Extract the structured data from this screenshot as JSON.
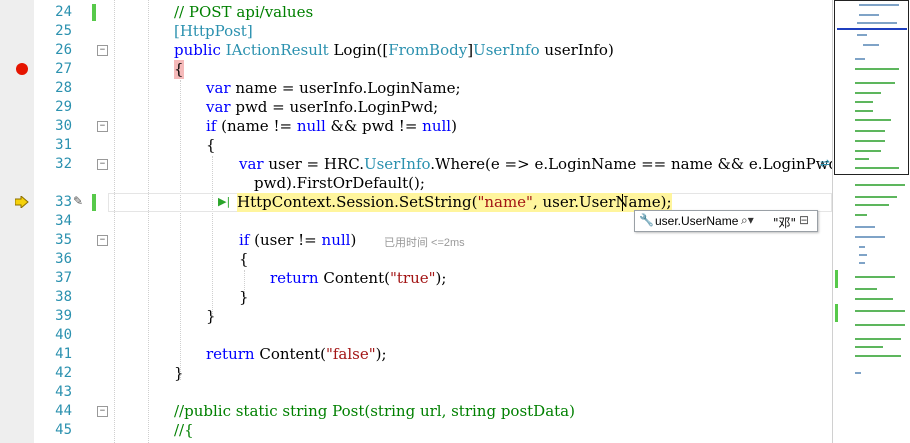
{
  "lines": [
    {
      "num": "24",
      "text": "// POST api/values"
    },
    {
      "num": "25",
      "text": "[HttpPost]"
    },
    {
      "num": "26",
      "text": "public IActionResult Login([FromBody]UserInfo userInfo)"
    },
    {
      "num": "27",
      "text": "{"
    },
    {
      "num": "28",
      "text": "var name = userInfo.LoginName;"
    },
    {
      "num": "29",
      "text": "var pwd = userInfo.LoginPwd;"
    },
    {
      "num": "30",
      "text": "if (name != null && pwd != null)"
    },
    {
      "num": "31",
      "text": "{"
    },
    {
      "num": "32",
      "text": "var user = HRC.UserInfo.Where(e => e.LoginName == name && e.LoginPwd =="
    },
    {
      "num": "",
      "text": "pwd).FirstOrDefault();"
    },
    {
      "num": "33",
      "text": "HttpContext.Session.SetString(\"name\", user.UserName);"
    },
    {
      "num": "34",
      "text": ""
    },
    {
      "num": "35",
      "text": "if (user != null)"
    },
    {
      "num": "36",
      "text": "{"
    },
    {
      "num": "37",
      "text": "return Content(\"true\");"
    },
    {
      "num": "38",
      "text": "}"
    },
    {
      "num": "39",
      "text": "}"
    },
    {
      "num": "40",
      "text": ""
    },
    {
      "num": "41",
      "text": "return Content(\"false\");"
    },
    {
      "num": "42",
      "text": "}"
    },
    {
      "num": "43",
      "text": ""
    },
    {
      "num": "44",
      "text": "//public static string Post(string url, string postData)"
    },
    {
      "num": "45",
      "text": "//{"
    }
  ],
  "perf_tip": "已用时间 <=2ms",
  "datatip": {
    "expression": "user.UserName",
    "value": "\"邓\""
  },
  "colors": {
    "keyword": "#0000ff",
    "type": "#2b91af",
    "comment": "#008000",
    "string": "#a31515",
    "breakpoint": "#e51400",
    "highlight": "#fff59d"
  },
  "icons": [
    "breakpoint-icon",
    "instruction-pointer-icon",
    "pencil-icon",
    "run-to-cursor-icon",
    "wrench-icon",
    "magnifier-icon",
    "pin-icon",
    "code-lens-icon"
  ]
}
